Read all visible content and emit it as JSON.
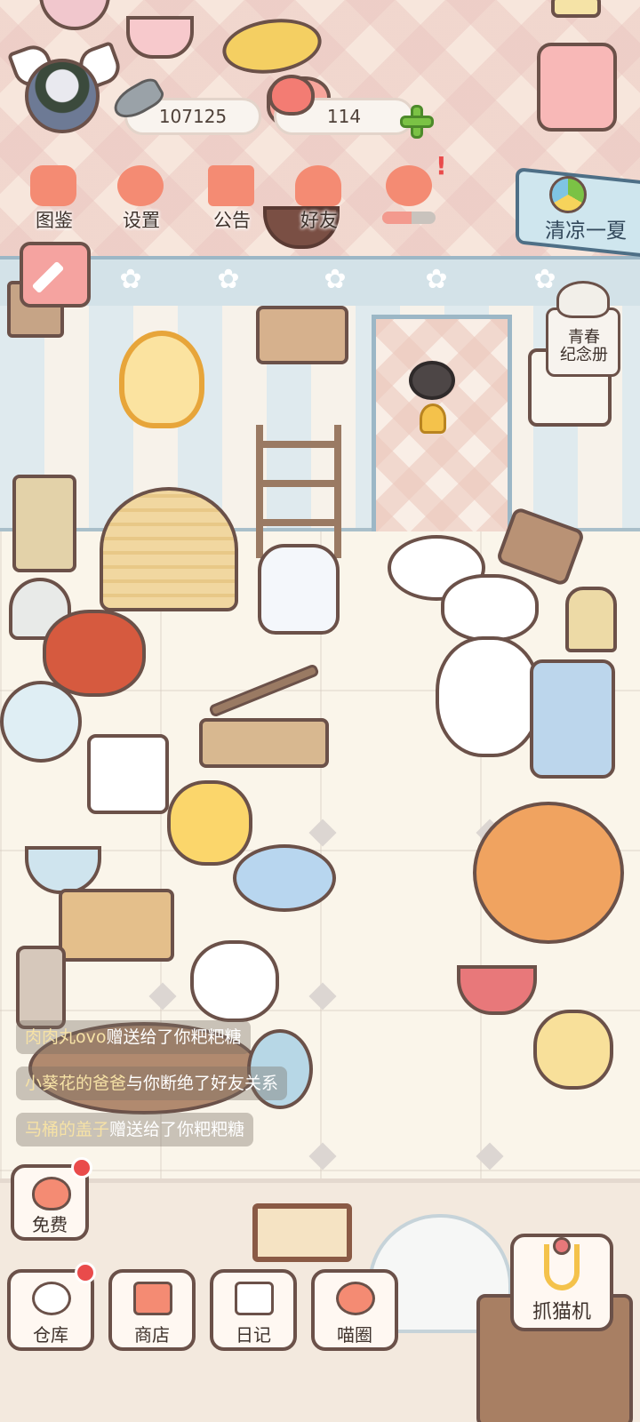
{
  "player": {
    "fish_count": "107125",
    "heart_count": "114"
  },
  "menu": [
    {
      "label": "图鉴",
      "icon": "cat-head-icon"
    },
    {
      "label": "设置",
      "icon": "gear-icon"
    },
    {
      "label": "公告",
      "icon": "gift-icon"
    },
    {
      "label": "好友",
      "icon": "friends-icon"
    }
  ],
  "event": {
    "label": "清凉一夏"
  },
  "memorial": {
    "line1": "青春",
    "line2": "纪念册"
  },
  "chat": [
    {
      "name": "肉肉丸ovo",
      "text": "赠送给了你粑粑糖"
    },
    {
      "name": "小葵花的爸爸",
      "text": "与你断绝了好友关系"
    },
    {
      "name": "马桶的盖子",
      "text": "赠送给了你粑粑糖"
    }
  ],
  "bottom": {
    "free": "免费",
    "warehouse": "仓库",
    "shop": "商店",
    "diary": "日记",
    "cat_circle": "喵圈",
    "claw_machine": "抓猫机"
  },
  "colors": {
    "accent": "#f48b73",
    "outline": "#6b5149",
    "notification": "#e94b4b",
    "plus": "#7bc245"
  }
}
